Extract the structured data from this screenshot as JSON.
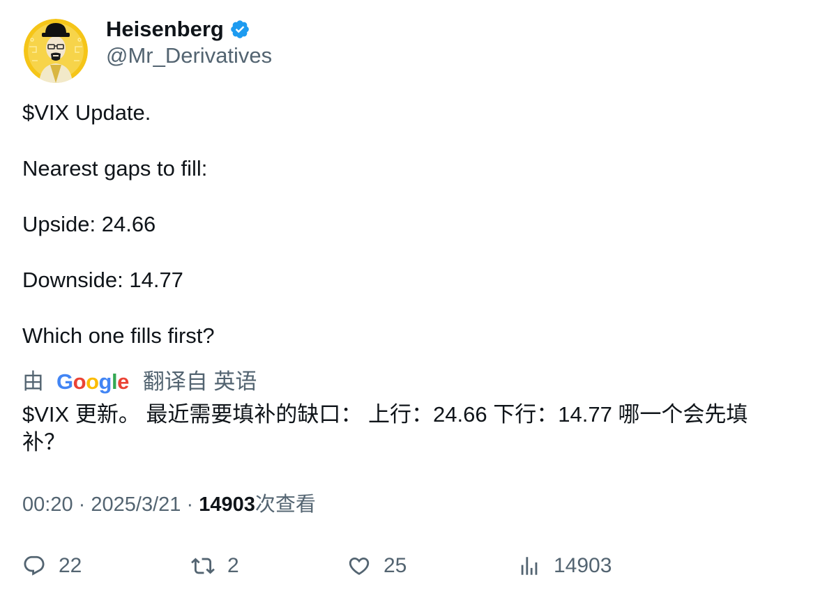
{
  "author": {
    "display_name": "Heisenberg",
    "handle": "@Mr_Derivatives",
    "verified": true
  },
  "tweet": {
    "lines": [
      "$VIX Update.",
      "Nearest gaps to fill:",
      "Upside: 24.66",
      "Downside: 14.77",
      "Which one fills first?"
    ]
  },
  "translation": {
    "prefix": "由",
    "provider": "Google",
    "suffix": "翻译自 英语",
    "text": "$VIX 更新。 最近需要填补的缺口： 上行：24.66 下行：14.77 哪一个会先填补？"
  },
  "meta": {
    "time": "00:20",
    "separator": "·",
    "date": "2025/3/21",
    "views_count": "14903",
    "views_label": "次查看"
  },
  "actions": {
    "replies": "22",
    "retweets": "2",
    "likes": "25",
    "views": "14903"
  },
  "colors": {
    "text": "#0f1419",
    "muted": "#536471",
    "verified": "#1d9bf0",
    "avatar_bg": "#f5c518"
  }
}
